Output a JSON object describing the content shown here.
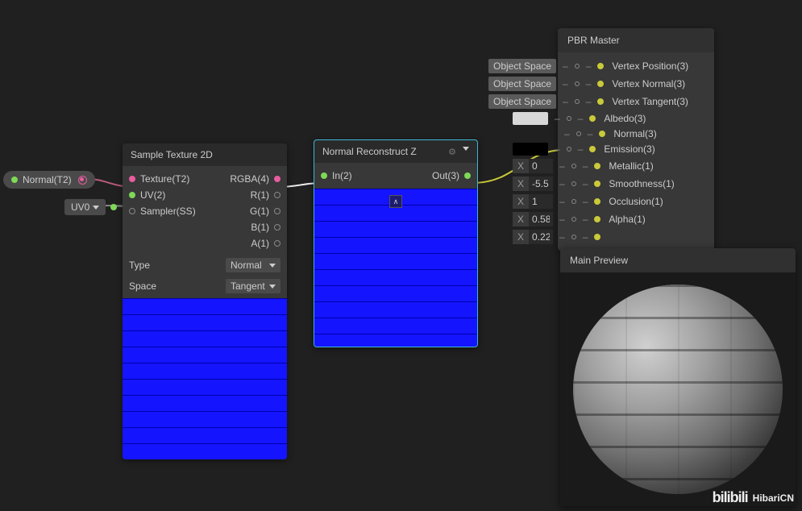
{
  "normalPill": {
    "label": "Normal(T2)"
  },
  "uvPill": {
    "label": "UV0"
  },
  "sampleNode": {
    "title": "Sample Texture 2D",
    "inputs": [
      "Texture(T2)",
      "UV(2)",
      "Sampler(SS)"
    ],
    "outputs": [
      "RGBA(4)",
      "R(1)",
      "G(1)",
      "B(1)",
      "A(1)"
    ],
    "typeLabel": "Type",
    "typeValue": "Normal",
    "spaceLabel": "Space",
    "spaceValue": "Tangent"
  },
  "reconstructNode": {
    "title": "Normal Reconstruct Z",
    "input": "In(2)",
    "output": "Out(3)"
  },
  "masterNode": {
    "title": "PBR Master",
    "rows": [
      {
        "chip": "Object Space",
        "label": "Vertex Position(3)"
      },
      {
        "chip": "Object Space",
        "label": "Vertex Normal(3)"
      },
      {
        "chip": "Object Space",
        "label": "Vertex Tangent(3)"
      },
      {
        "swatch": "#d8d8d8",
        "label": "Albedo(3)"
      },
      {
        "label": "Normal(3)"
      },
      {
        "swatch": "#000000",
        "label": "Emission(3)"
      },
      {
        "x": "0",
        "label": "Metallic(1)"
      },
      {
        "x": "-5.5",
        "label": "Smoothness(1)"
      },
      {
        "x": "1",
        "label": "Occlusion(1)"
      },
      {
        "x": "0.58",
        "label": "Alpha(1)"
      },
      {
        "x": "0.22",
        "label": ""
      }
    ]
  },
  "previewPanel": {
    "title": "Main Preview"
  },
  "watermark": {
    "text": "HibariCN",
    "logo": "bilibili"
  }
}
